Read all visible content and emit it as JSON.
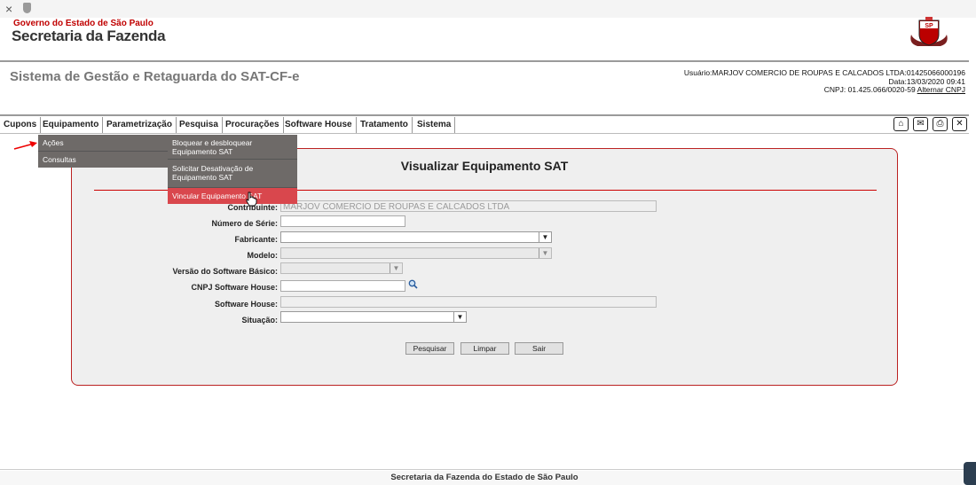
{
  "browser": {
    "close_glyph": "×",
    "shield_icon": "shield-icon"
  },
  "header": {
    "gov_label": "Governo do Estado de São Paulo",
    "secretaria": "Secretaria da Fazenda",
    "logo_icon": "sp-crest-logo",
    "system_title": "Sistema de Gestão e Retaguarda do SAT-CF-e",
    "user_line": "Usuário:MARJOV COMERCIO DE ROUPAS E CALCADOS LTDA:01425066000196",
    "date_line": "Data:13/03/2020 09:41",
    "cnpj_line": "CNPJ: 01.425.066/0020-59",
    "alt_cnpj": "Alternar CNPJ"
  },
  "menu": {
    "items": [
      "Cupons",
      "Equipamento",
      "Parametrização",
      "Pesquisa",
      "Procurações",
      "Software House",
      "Tratamento",
      "Sistema"
    ],
    "tools": [
      "home-icon",
      "mail-icon",
      "print-icon",
      "close-icon"
    ]
  },
  "dropdown1": {
    "items": [
      "Ações",
      "Consultas"
    ]
  },
  "dropdown2": {
    "items": [
      "Bloquear e desbloquear Equipamento SAT",
      "Solicitar Desativação de Equipamento SAT",
      "Vincular Equipamento SAT"
    ],
    "highlighted": "Vincular Equipamento SAT"
  },
  "form": {
    "title": "Visualizar Equipamento SAT",
    "contribuinte_label": "Contribuinte:",
    "contribuinte_value": "MARJOV COMERCIO DE ROUPAS E CALCADOS LTDA",
    "numero_serie_label": "Número de Série:",
    "numero_serie_value": "",
    "fabricante_label": "Fabricante:",
    "fabricante_value": "",
    "modelo_label": "Modelo:",
    "modelo_value": "",
    "versao_label": "Versão do Software Básico:",
    "versao_value": "",
    "cnpj_sh_label": "CNPJ Software House:",
    "cnpj_sh_value": "",
    "software_house_label": "Software House:",
    "software_house_value": "",
    "situacao_label": "Situação:",
    "situacao_value": "",
    "buttons": {
      "pesquisar": "Pesquisar",
      "limpar": "Limpar",
      "sair": "Sair"
    }
  },
  "footer": {
    "text": "Secretaria da Fazenda do Estado de São Paulo"
  },
  "colors": {
    "accent_red": "#cc0000",
    "menu_bg": "#6e6a68",
    "highlight": "#d9474d"
  }
}
